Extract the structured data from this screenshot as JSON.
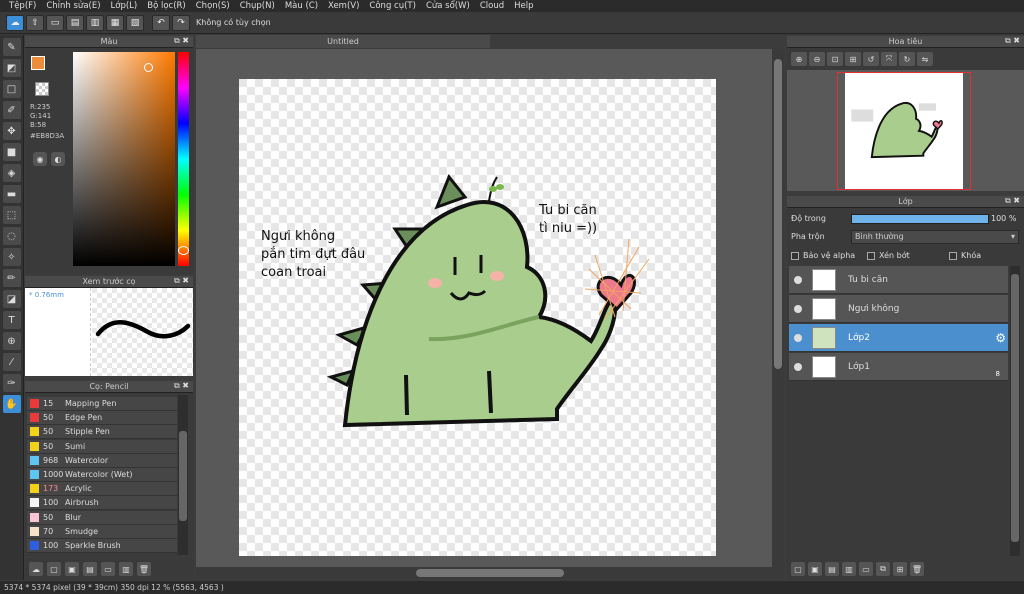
{
  "menu": [
    "Tệp(F)",
    "Chỉnh sửa(E)",
    "Lớp(L)",
    "Bộ lọc(R)",
    "Chọn(S)",
    "Chụp(N)",
    "Màu (C)",
    "Xem(V)",
    "Công cụ(T)",
    "Cửa sổ(W)",
    "Cloud",
    "Help"
  ],
  "toolbar": {
    "option_text": "Không có tùy chọn"
  },
  "color_panel": {
    "title": "Màu",
    "r": "R:235",
    "g": "G:141",
    "b": "B:58",
    "hex": "#EB8D3A",
    "fg_color": "#EB8D3A"
  },
  "preview_panel": {
    "title": "Xem trước cọ",
    "size": "* 0.76mm"
  },
  "brush_panel": {
    "title": "Cọ: Pencil",
    "brushes": [
      {
        "size": "15",
        "name": "Mapping Pen",
        "color": "#e83a3a"
      },
      {
        "size": "50",
        "name": "Edge Pen",
        "color": "#e83a3a"
      },
      {
        "size": "50",
        "name": "Stipple Pen",
        "color": "#f2d21b"
      },
      {
        "size": "50",
        "name": "Sumi",
        "color": "#f2d21b"
      },
      {
        "size": "968",
        "name": "Watercolor",
        "color": "#5fc4ef"
      },
      {
        "size": "1000",
        "name": "Watercolor (Wet)",
        "color": "#5fc4ef"
      },
      {
        "size": "173",
        "name": "Acrylic",
        "color": "#f2d21b"
      },
      {
        "size": "100",
        "name": "Airbrush",
        "color": "#f4f4f4"
      },
      {
        "size": "50",
        "name": "Blur",
        "color": "#f9c4d4"
      },
      {
        "size": "70",
        "name": "Smudge",
        "color": "#f6e2c8"
      },
      {
        "size": "100",
        "name": "Sparkle Brush",
        "color": "#2f5ee0"
      }
    ]
  },
  "document": {
    "tab_title": "Untitled"
  },
  "canvas_text": {
    "left_line1": "Ngưi không",
    "left_line2": "pắn tim đựt đâu",
    "left_line3": "coan troai",
    "right_line1": "Tu bi căn",
    "right_line2": "tì niu =))"
  },
  "navigator": {
    "title": "Hoa tiêu"
  },
  "layers": {
    "title": "Lớp",
    "opacity_label": "Độ trong",
    "opacity_value": "100 %",
    "blend_label": "Pha trộn",
    "blend_value": "Bình thường",
    "protect_alpha": "Bảo vệ alpha",
    "clipping": "Xén bớt",
    "lock": "Khóa",
    "items": [
      {
        "name": "Tu bi căn",
        "selected": false
      },
      {
        "name": "Ngưi không",
        "selected": false
      },
      {
        "name": "Lớp2",
        "selected": true
      },
      {
        "name": "Lớp1",
        "selected": false
      }
    ],
    "layer1_badge": "8"
  },
  "status": "5374 * 5374 pixel   (39 * 39cm)   350 dpi   12 %   (5563, 4563 )"
}
